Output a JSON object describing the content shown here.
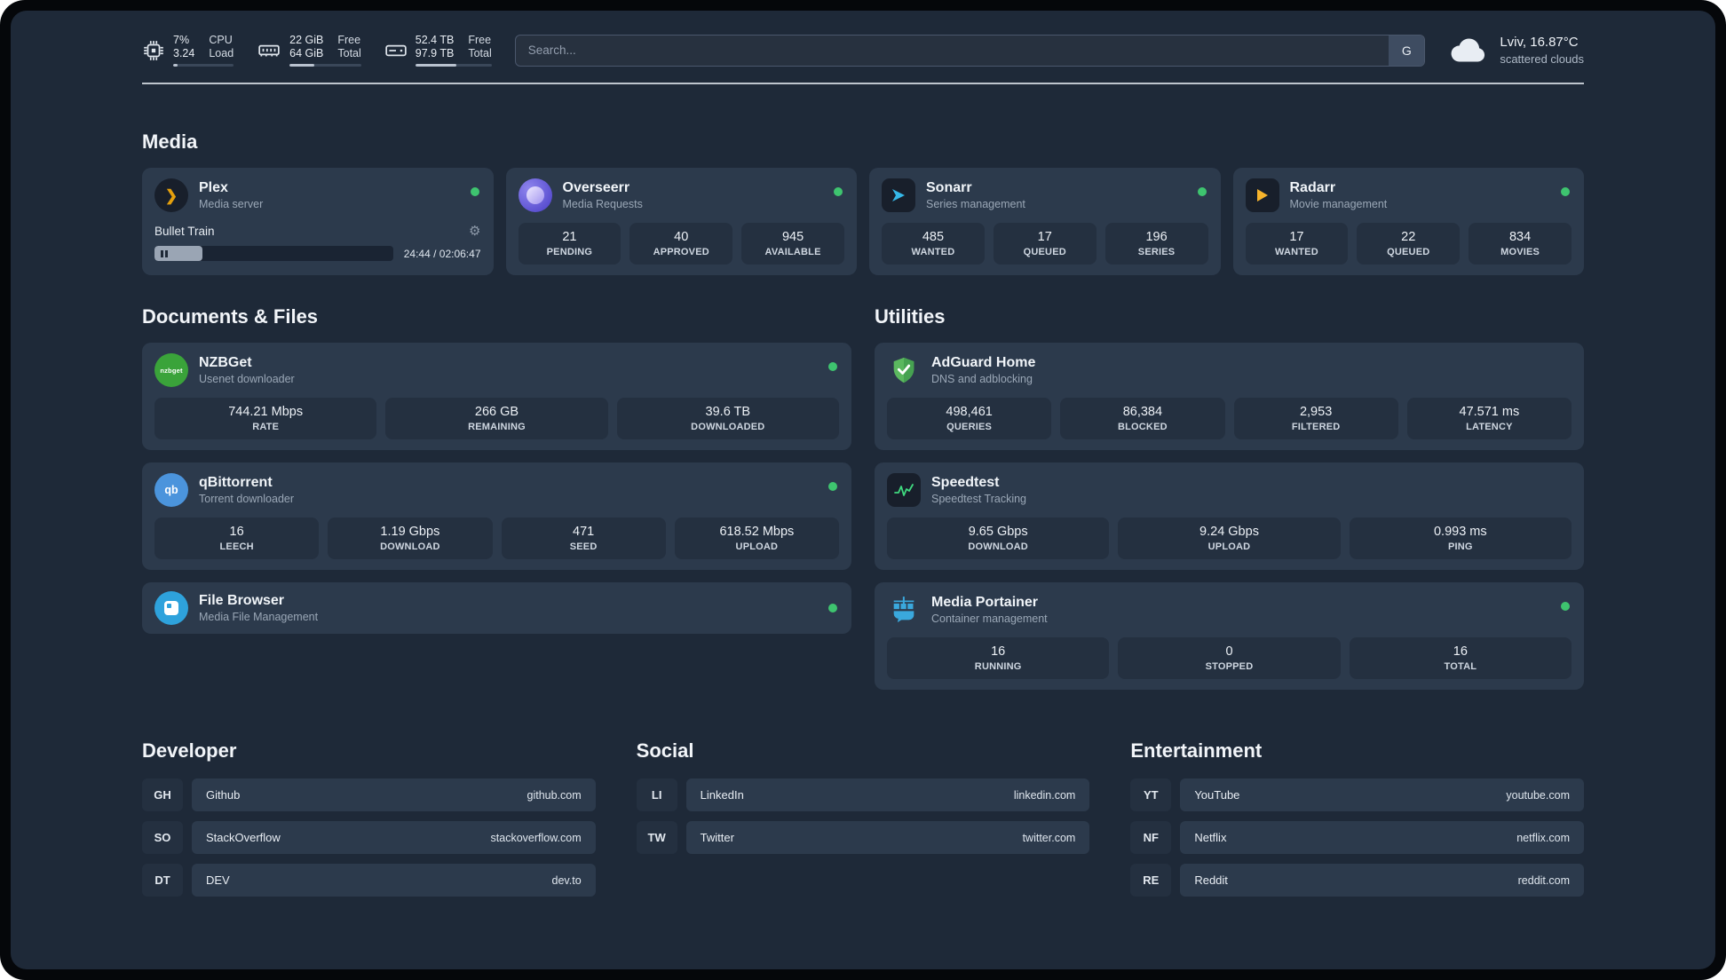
{
  "topbar": {
    "cpu": {
      "value_top": "7%",
      "value_bottom": "3.24",
      "label_top": "CPU",
      "label_bottom": "Load",
      "bar": "7%"
    },
    "ram": {
      "value_top": "22 GiB",
      "value_bottom": "64 GiB",
      "label_top": "Free",
      "label_bottom": "Total",
      "bar": "34%"
    },
    "disk": {
      "value_top": "52.4 TB",
      "value_bottom": "97.9 TB",
      "label_top": "Free",
      "label_bottom": "Total",
      "bar": "54%"
    },
    "search": {
      "placeholder": "Search...",
      "engine_label": "G"
    },
    "weather": {
      "location": "Lviv, 16.87°C",
      "condition": "scattered clouds"
    }
  },
  "sections": {
    "media": {
      "title": "Media"
    },
    "documents": {
      "title": "Documents & Files"
    },
    "utilities": {
      "title": "Utilities"
    }
  },
  "icons": {
    "plex_glyph": "❯",
    "gear": "⚙",
    "nzbget_text": "nzbget",
    "qb_text": "qb"
  },
  "apps": {
    "plex": {
      "name": "Plex",
      "subtitle": "Media server",
      "player": {
        "title": "Bullet Train",
        "time": "24:44 / 02:06:47",
        "progress": "20%"
      }
    },
    "overseerr": {
      "name": "Overseerr",
      "subtitle": "Media Requests",
      "stats": [
        {
          "value": "21",
          "label": "PENDING"
        },
        {
          "value": "40",
          "label": "APPROVED"
        },
        {
          "value": "945",
          "label": "AVAILABLE"
        }
      ]
    },
    "sonarr": {
      "name": "Sonarr",
      "subtitle": "Series management",
      "stats": [
        {
          "value": "485",
          "label": "WANTED"
        },
        {
          "value": "17",
          "label": "QUEUED"
        },
        {
          "value": "196",
          "label": "SERIES"
        }
      ]
    },
    "radarr": {
      "name": "Radarr",
      "subtitle": "Movie management",
      "stats": [
        {
          "value": "17",
          "label": "WANTED"
        },
        {
          "value": "22",
          "label": "QUEUED"
        },
        {
          "value": "834",
          "label": "MOVIES"
        }
      ]
    },
    "nzbget": {
      "name": "NZBGet",
      "subtitle": "Usenet downloader",
      "stats": [
        {
          "value": "744.21 Mbps",
          "label": "RATE"
        },
        {
          "value": "266 GB",
          "label": "REMAINING"
        },
        {
          "value": "39.6 TB",
          "label": "DOWNLOADED"
        }
      ]
    },
    "qbittorrent": {
      "name": "qBittorrent",
      "subtitle": "Torrent downloader",
      "stats": [
        {
          "value": "16",
          "label": "LEECH"
        },
        {
          "value": "1.19 Gbps",
          "label": "DOWNLOAD"
        },
        {
          "value": "471",
          "label": "SEED"
        },
        {
          "value": "618.52 Mbps",
          "label": "UPLOAD"
        }
      ]
    },
    "filebrowser": {
      "name": "File Browser",
      "subtitle": "Media File Management"
    },
    "adguard": {
      "name": "AdGuard Home",
      "subtitle": "DNS and adblocking",
      "stats": [
        {
          "value": "498,461",
          "label": "QUERIES"
        },
        {
          "value": "86,384",
          "label": "BLOCKED"
        },
        {
          "value": "2,953",
          "label": "FILTERED"
        },
        {
          "value": "47.571 ms",
          "label": "LATENCY"
        }
      ]
    },
    "speedtest": {
      "name": "Speedtest",
      "subtitle": "Speedtest Tracking",
      "stats": [
        {
          "value": "9.65 Gbps",
          "label": "DOWNLOAD"
        },
        {
          "value": "9.24 Gbps",
          "label": "UPLOAD"
        },
        {
          "value": "0.993 ms",
          "label": "PING"
        }
      ]
    },
    "portainer": {
      "name": "Media Portainer",
      "subtitle": "Container management",
      "stats": [
        {
          "value": "16",
          "label": "RUNNING"
        },
        {
          "value": "0",
          "label": "STOPPED"
        },
        {
          "value": "16",
          "label": "TOTAL"
        }
      ]
    }
  },
  "bookmarks": {
    "developer": {
      "title": "Developer",
      "items": [
        {
          "abbr": "GH",
          "name": "Github",
          "url": "github.com"
        },
        {
          "abbr": "SO",
          "name": "StackOverflow",
          "url": "stackoverflow.com"
        },
        {
          "abbr": "DT",
          "name": "DEV",
          "url": "dev.to"
        }
      ]
    },
    "social": {
      "title": "Social",
      "items": [
        {
          "abbr": "LI",
          "name": "LinkedIn",
          "url": "linkedin.com"
        },
        {
          "abbr": "TW",
          "name": "Twitter",
          "url": "twitter.com"
        }
      ]
    },
    "entertainment": {
      "title": "Entertainment",
      "items": [
        {
          "abbr": "YT",
          "name": "YouTube",
          "url": "youtube.com"
        },
        {
          "abbr": "NF",
          "name": "Netflix",
          "url": "netflix.com"
        },
        {
          "abbr": "RE",
          "name": "Reddit",
          "url": "reddit.com"
        }
      ]
    }
  }
}
